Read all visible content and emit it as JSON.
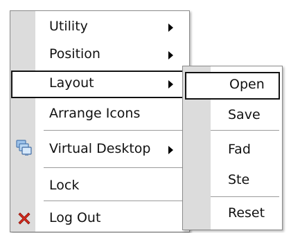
{
  "main_menu": {
    "items": [
      {
        "label": "Utility"
      },
      {
        "label": "Position"
      },
      {
        "label": "Layout"
      },
      {
        "label": "Arrange Icons"
      },
      {
        "label": "Virtual Desktop"
      },
      {
        "label": "Lock"
      },
      {
        "label": "Log Out"
      }
    ]
  },
  "submenu": {
    "items": [
      {
        "label": "Open"
      },
      {
        "label": "Save"
      },
      {
        "label": "Fad"
      },
      {
        "label": "Ste"
      },
      {
        "label": "Reset"
      }
    ]
  },
  "icons": {
    "virtual_desktop": "virtual-desktop-icon",
    "log_out": "red-x-icon"
  },
  "colors": {
    "gutter": "#dcdcdc",
    "border": "#8a8a8a",
    "selected_border": "#111111",
    "logout_x": "#d42a1e"
  }
}
